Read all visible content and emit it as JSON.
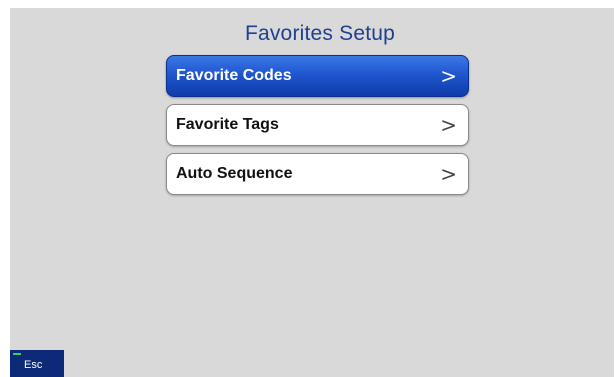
{
  "page": {
    "title": "Favorites Setup"
  },
  "menu": {
    "items": [
      {
        "label": "Favorite Codes",
        "selected": true
      },
      {
        "label": "Favorite Tags",
        "selected": false
      },
      {
        "label": "Auto Sequence",
        "selected": false
      }
    ],
    "chevron": ">"
  },
  "footer": {
    "esc_label": "Esc"
  },
  "colors": {
    "background": "#d9d9d9",
    "title": "#1f3f8f",
    "selected_item": "#1f56cf",
    "esc_button": "#0d2a78",
    "esc_indicator": "#36d05a"
  }
}
